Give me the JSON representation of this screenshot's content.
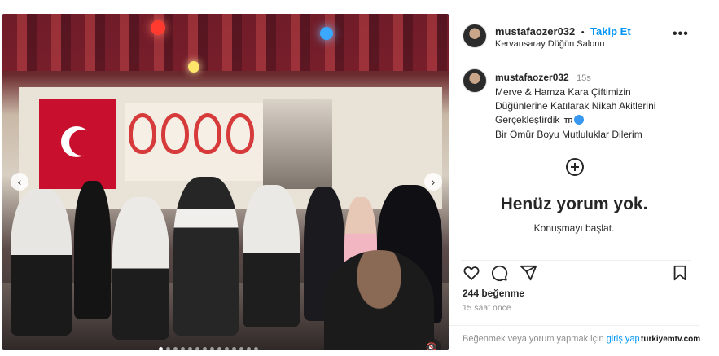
{
  "post": {
    "username": "mustafaozer032",
    "separator": "•",
    "follow_label": "Takip Et",
    "location": "Kervansaray Düğün Salonu",
    "more_icon": "more-horizontal-icon"
  },
  "caption": {
    "username": "mustafaozer032",
    "time": "15s",
    "lines": [
      "Merve & Hamza Kara Çiftimizin",
      "Düğünlerine Katılarak Nikah Akitlerini",
      "Gerçekleştirdik",
      "Bir Ömür Boyu Mutluluklar Dilerim"
    ],
    "flag_text": "TR"
  },
  "comments": {
    "empty_title": "Henüz yorum yok.",
    "empty_subtitle": "Konuşmayı başlat."
  },
  "stats": {
    "likes": "244 beğenme",
    "time_ago": "15 saat önce"
  },
  "login": {
    "prompt": "Beğenmek veya yorum yapmak için ",
    "link": "giriş yap"
  },
  "carousel": {
    "total": 14,
    "active": 1
  },
  "watermark": "turkiyemtv.com"
}
